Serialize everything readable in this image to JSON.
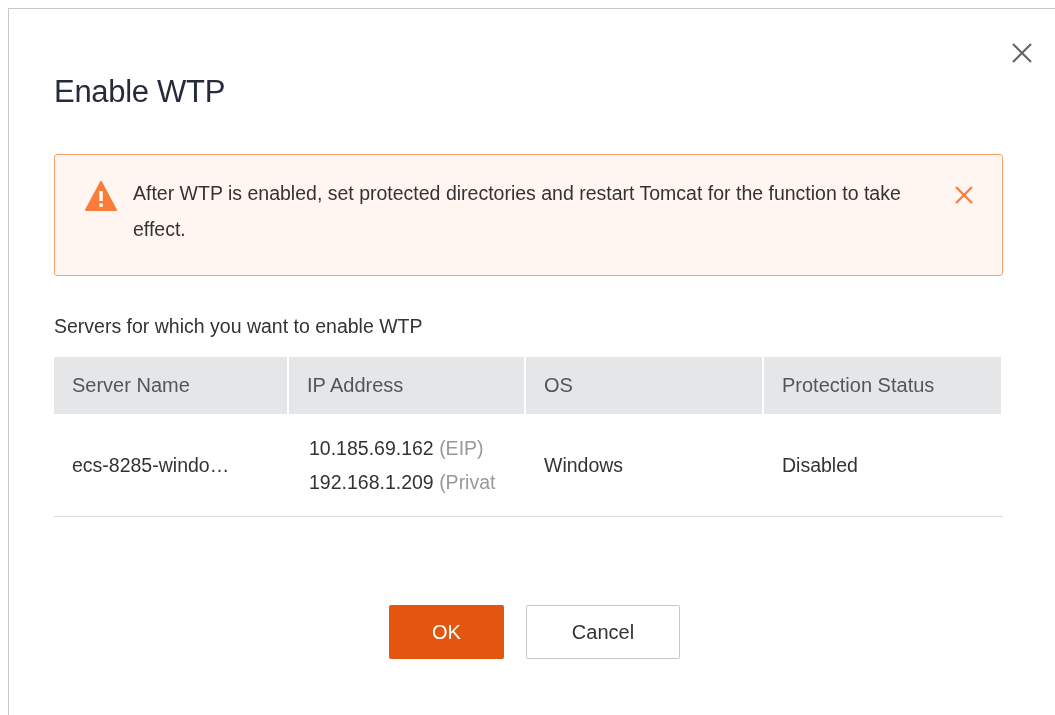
{
  "dialog": {
    "title": "Enable WTP"
  },
  "alert": {
    "message": "After WTP is enabled, set protected directories and restart Tomcat for the function to take effect."
  },
  "subtitle": "Servers for which you want to enable WTP",
  "table": {
    "columns": [
      "Server Name",
      "IP Address",
      "OS",
      "Protection Status"
    ],
    "rows": [
      {
        "server_name": "ecs-8285-windo…",
        "ip_addresses": [
          {
            "ip": "10.185.69.162",
            "tag": "(EIP)"
          },
          {
            "ip": "192.168.1.209",
            "tag": "(Privat"
          }
        ],
        "os": "Windows",
        "protection_status": "Disabled"
      }
    ]
  },
  "buttons": [
    {
      "label": "OK",
      "kind": "primary"
    },
    {
      "label": "Cancel",
      "kind": "secondary"
    }
  ]
}
